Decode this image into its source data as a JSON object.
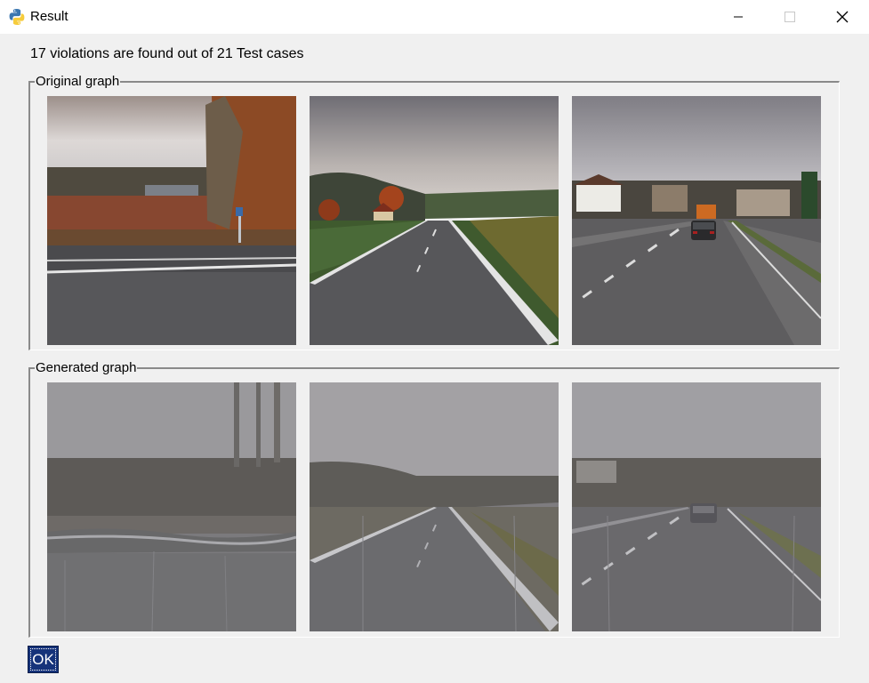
{
  "window": {
    "title": "Result",
    "icon": "python-icon",
    "controls": [
      "minimize-icon",
      "maximize-icon",
      "close-icon"
    ]
  },
  "summary": "17 violations are found out of 21 Test cases",
  "groups": {
    "original": {
      "label": "Original graph",
      "images": [
        {
          "scene": "rural intersection with autumn trees and overcast sky"
        },
        {
          "scene": "country road curving past a red-roofed house and fields"
        },
        {
          "scene": "town street with a dark car ahead and houses"
        }
      ]
    },
    "generated": {
      "label": "Generated graph",
      "images": [
        {
          "scene": "rainy foggy version of rural intersection"
        },
        {
          "scene": "rainy foggy version of country road"
        },
        {
          "scene": "rainy foggy version of town street with car"
        }
      ]
    }
  },
  "buttons": {
    "ok": "OK"
  },
  "colors": {
    "window_bg": "#f0f0f0",
    "titlebar_bg": "#ffffff",
    "ok_button_bg": "#16337a"
  }
}
